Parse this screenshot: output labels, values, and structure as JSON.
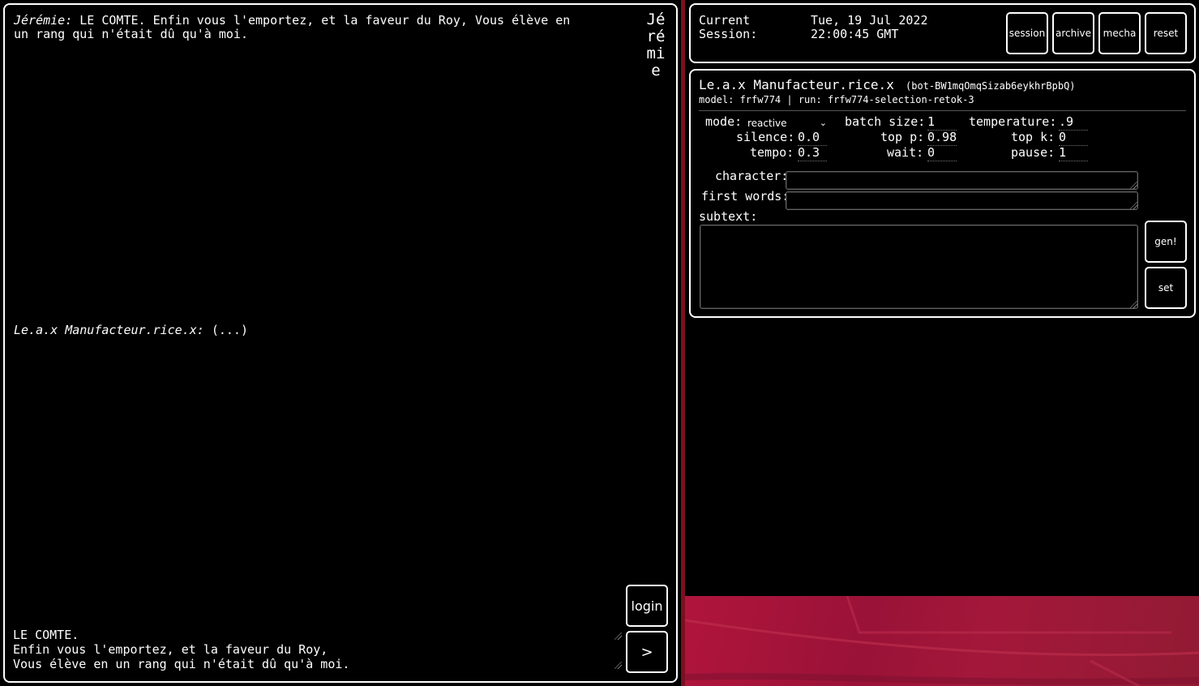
{
  "chat": {
    "messages": [
      {
        "speaker": "Jérémie:",
        "text": " LE COMTE. Enfin vous l'emportez, et la faveur du Roy, Vous élève en\nun rang qui n'était dû qu'à moi."
      },
      {
        "speaker": "Le.a.x Manufacteur.rice.x:",
        "text": " (...)"
      }
    ],
    "user_badge": "Jérémie",
    "input_value": "LE COMTE.\nEnfin vous l'emportez, et la faveur du Roy,\nVous élève en un rang qui n'était dû qu'à moi.",
    "login_label": "login",
    "send_label": ">"
  },
  "session": {
    "label": "Current\nSession:",
    "date": "Tue, 19 Jul 2022",
    "time": "22:00:45 GMT",
    "buttons": [
      "session",
      "archive",
      "mecha",
      "reset"
    ]
  },
  "bot": {
    "name": "Le.a.x Manufacteur.rice.x",
    "id": "(bot-BW1mqOmqSizab6eykhrBpbQ)",
    "meta": "model: frfw774 | run: frfw774-selection-retok-3",
    "mode_label": "mode:",
    "mode_value": "reactive",
    "batch_size_label": "batch size:",
    "batch_size": "1",
    "temperature_label": "temperature:",
    "temperature": ".9",
    "silence_label": "silence:",
    "silence": "0.0",
    "top_p_label": "top p:",
    "top_p": "0.98",
    "top_k_label": "top k:",
    "top_k": "0",
    "tempo_label": "tempo:",
    "tempo": "0.3",
    "wait_label": "wait:",
    "wait": "0",
    "pause_label": "pause:",
    "pause": "1",
    "character_label": "character:",
    "character_value": "",
    "first_words_label": "first words:",
    "first_words_value": "",
    "subtext_label": "subtext:",
    "subtext_value": "",
    "gen_label": "gen!",
    "set_label": "set"
  },
  "colors": {
    "background": "#000000",
    "foreground": "#ffffff",
    "divider": "#7a1020",
    "wallpaper": "#a3183a"
  }
}
